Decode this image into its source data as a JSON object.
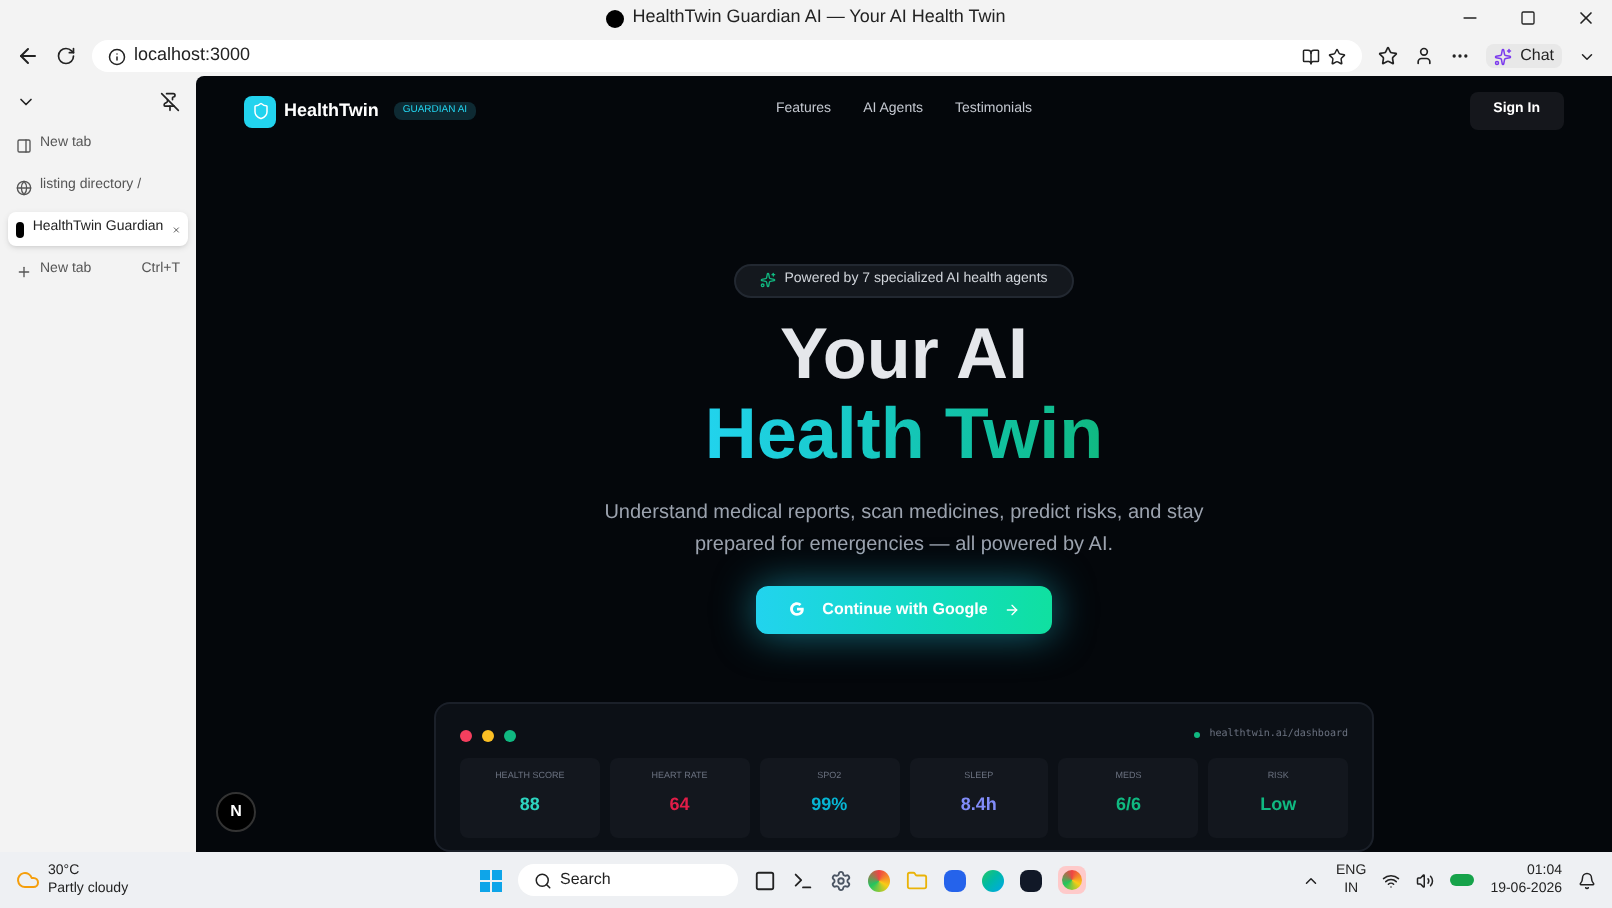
{
  "window": {
    "title": "HealthTwin Guardian AI — Your AI Health Twin"
  },
  "address_bar": {
    "url": "localhost:3000",
    "chat_label": "Chat"
  },
  "tabs": [
    {
      "label": "New tab",
      "selected": false
    },
    {
      "label": "listing directory /",
      "selected": false
    },
    {
      "label": "HealthTwin Guardian",
      "selected": true
    }
  ],
  "new_tab": {
    "label": "New tab",
    "shortcut": "Ctrl+T"
  },
  "site": {
    "brand": "HealthTwin",
    "badge": "GUARDIAN AI",
    "nav": [
      "Features",
      "AI Agents",
      "Testimonials"
    ],
    "sign_in": "Sign In",
    "pill": "Powered by 7 specialized AI health agents",
    "headline_1": "Your AI",
    "headline_2": "Health Twin",
    "subtitle": "Understand medical reports, scan medicines, predict risks, and stay prepared for emergencies — all powered by AI.",
    "cta": "Continue with Google",
    "dev_badge": "N",
    "dashboard": {
      "dots": [
        {
          "color": "#f43f5e"
        },
        {
          "color": "#fbbf24"
        },
        {
          "color": "#10b981"
        }
      ],
      "url": "healthtwin.ai/dashboard",
      "stats": [
        {
          "label": "HEALTH SCORE",
          "value": "88",
          "color": "#2dd4bf"
        },
        {
          "label": "HEART RATE",
          "value": "64",
          "color": "#e11d48"
        },
        {
          "label": "SPO2",
          "value": "99%",
          "color": "#06b6d4"
        },
        {
          "label": "SLEEP",
          "value": "8.4h",
          "color": "#818cf8"
        },
        {
          "label": "MEDS",
          "value": "6/6",
          "color": "#10b981"
        },
        {
          "label": "RISK",
          "value": "Low",
          "color": "#10b981"
        }
      ]
    }
  },
  "taskbar": {
    "weather_temp": "30°C",
    "weather_desc": "Partly cloudy",
    "search": "Search",
    "lang_1": "ENG",
    "lang_2": "IN",
    "time": "01:04",
    "date": "19-06-2026"
  }
}
